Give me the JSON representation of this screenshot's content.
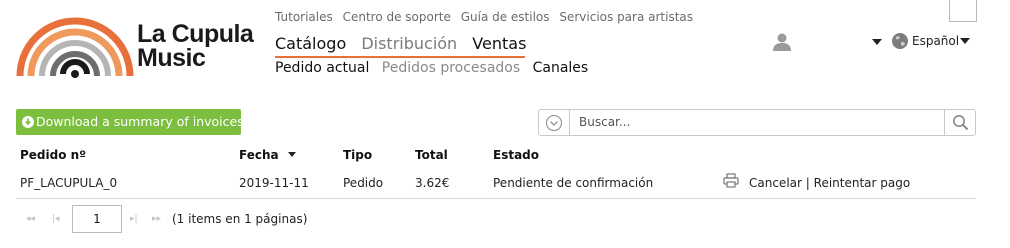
{
  "brand": {
    "line1": "La Cupula",
    "line2": "Music"
  },
  "top_links": [
    "Tutoriales",
    "Centro de soporte",
    "Guía de estilos",
    "Servicios para artistas"
  ],
  "main_nav": [
    {
      "label": "Catálogo",
      "active": true
    },
    {
      "label": "Distribución",
      "active": false
    },
    {
      "label": "Ventas",
      "active": true
    }
  ],
  "sub_nav": [
    {
      "label": "Pedido actual",
      "active": true
    },
    {
      "label": "Pedidos procesados",
      "active": false
    },
    {
      "label": "Canales",
      "active": true
    }
  ],
  "language": "Español",
  "download_button": "Download a summary of invoices",
  "search": {
    "placeholder": "Buscar..."
  },
  "table": {
    "headers": [
      "Pedido nº",
      "Fecha",
      "Tipo",
      "Total",
      "Estado"
    ],
    "sort_column": "Fecha",
    "rows": [
      {
        "pedido": "PF_LACUPULA_0",
        "fecha": "2019-11-11",
        "tipo": "Pedido",
        "total": "3.62€",
        "estado": "Pendiente de confirmación",
        "cancel": "Cancelar",
        "separator": "|",
        "retry": "Reintentar pago"
      }
    ]
  },
  "pager": {
    "page": "1",
    "info": "(1 items en 1 páginas)"
  },
  "colors": {
    "accent": "#e8703a",
    "button_green": "#7cbf3e",
    "logo_dark": "#3a3a3a"
  }
}
